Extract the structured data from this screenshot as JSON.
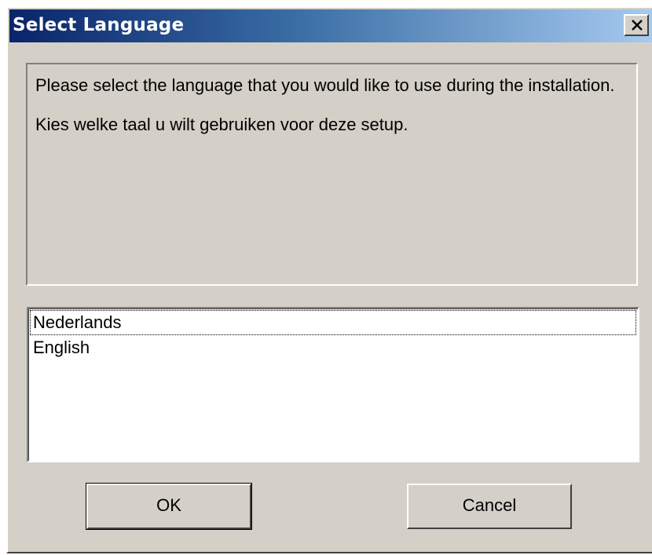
{
  "window": {
    "title": "Select Language",
    "close_label": "Close"
  },
  "message": {
    "line1": "Please select the language that you would like to use during the installation.",
    "line2": "Kies welke taal u wilt gebruiken voor deze setup."
  },
  "languages": {
    "items": [
      {
        "label": "Nederlands",
        "focused": true
      },
      {
        "label": "English",
        "focused": false
      }
    ]
  },
  "buttons": {
    "ok_label": "OK",
    "cancel_label": "Cancel"
  },
  "colors": {
    "face": "#d4d0c8",
    "title_start": "#0a246a",
    "title_end": "#a6caf0"
  }
}
